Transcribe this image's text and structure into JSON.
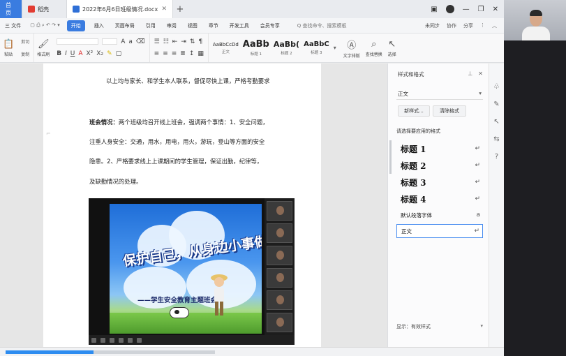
{
  "titlebar": {
    "tabs": [
      {
        "label": "首页"
      },
      {
        "label": "稻壳"
      },
      {
        "label": "2022年6月6日班级情况.docx"
      }
    ]
  },
  "menubar": {
    "file": "三 文件",
    "items": [
      "开始",
      "插入",
      "页面布局",
      "引用",
      "审阅",
      "视图",
      "章节",
      "开发工具",
      "会员专享"
    ],
    "search": "Q 查找命令、搜索模板",
    "right": [
      "未同步",
      "协作",
      "分享"
    ]
  },
  "ribbon": {
    "paste": "粘贴",
    "cut": "剪切",
    "copy": "复制",
    "format_painter": "格式刷",
    "styles": [
      {
        "sample": "AaBbCcDd",
        "label": "正文"
      },
      {
        "sample": "AaBb",
        "label": "标题 1"
      },
      {
        "sample": "AaBb(",
        "label": "标题 2"
      },
      {
        "sample": "AaBbC",
        "label": "标题 3"
      }
    ],
    "text_tools": "文字排版",
    "find_replace": "查找替换",
    "select": "选择"
  },
  "document": {
    "line1": "以上均与家长、和学生本人联系，督促尽快上课，严格考勤要求",
    "para_heading": "班会情况：",
    "line2": "两个班级均召开线上班会，强调两个事情：1、安全问题，",
    "line3": "注重人身安全：交通，用水，用电，用火，游玩，登山等方面的安全",
    "line4": "隐患。2、严格要求线上上课期间的学生管理，保证出勤，纪律等，",
    "line5": "及缺勤情况的处理。"
  },
  "slide": {
    "title": "保护自己，从身边小事做起",
    "subtitle": "——学生安全教育主题班会"
  },
  "style_pane": {
    "header": "样式和格式",
    "current": "正文",
    "new_style": "新样式...",
    "clear_format": "清除格式",
    "section_label": "请选择要应用的格式",
    "styles": [
      "标题 1",
      "标题 2",
      "标题 3",
      "标题 4"
    ],
    "default_font": "默认段落字体",
    "selected": "正文",
    "footer": "显示：有效样式"
  },
  "status": {
    "progress": 0.42
  }
}
